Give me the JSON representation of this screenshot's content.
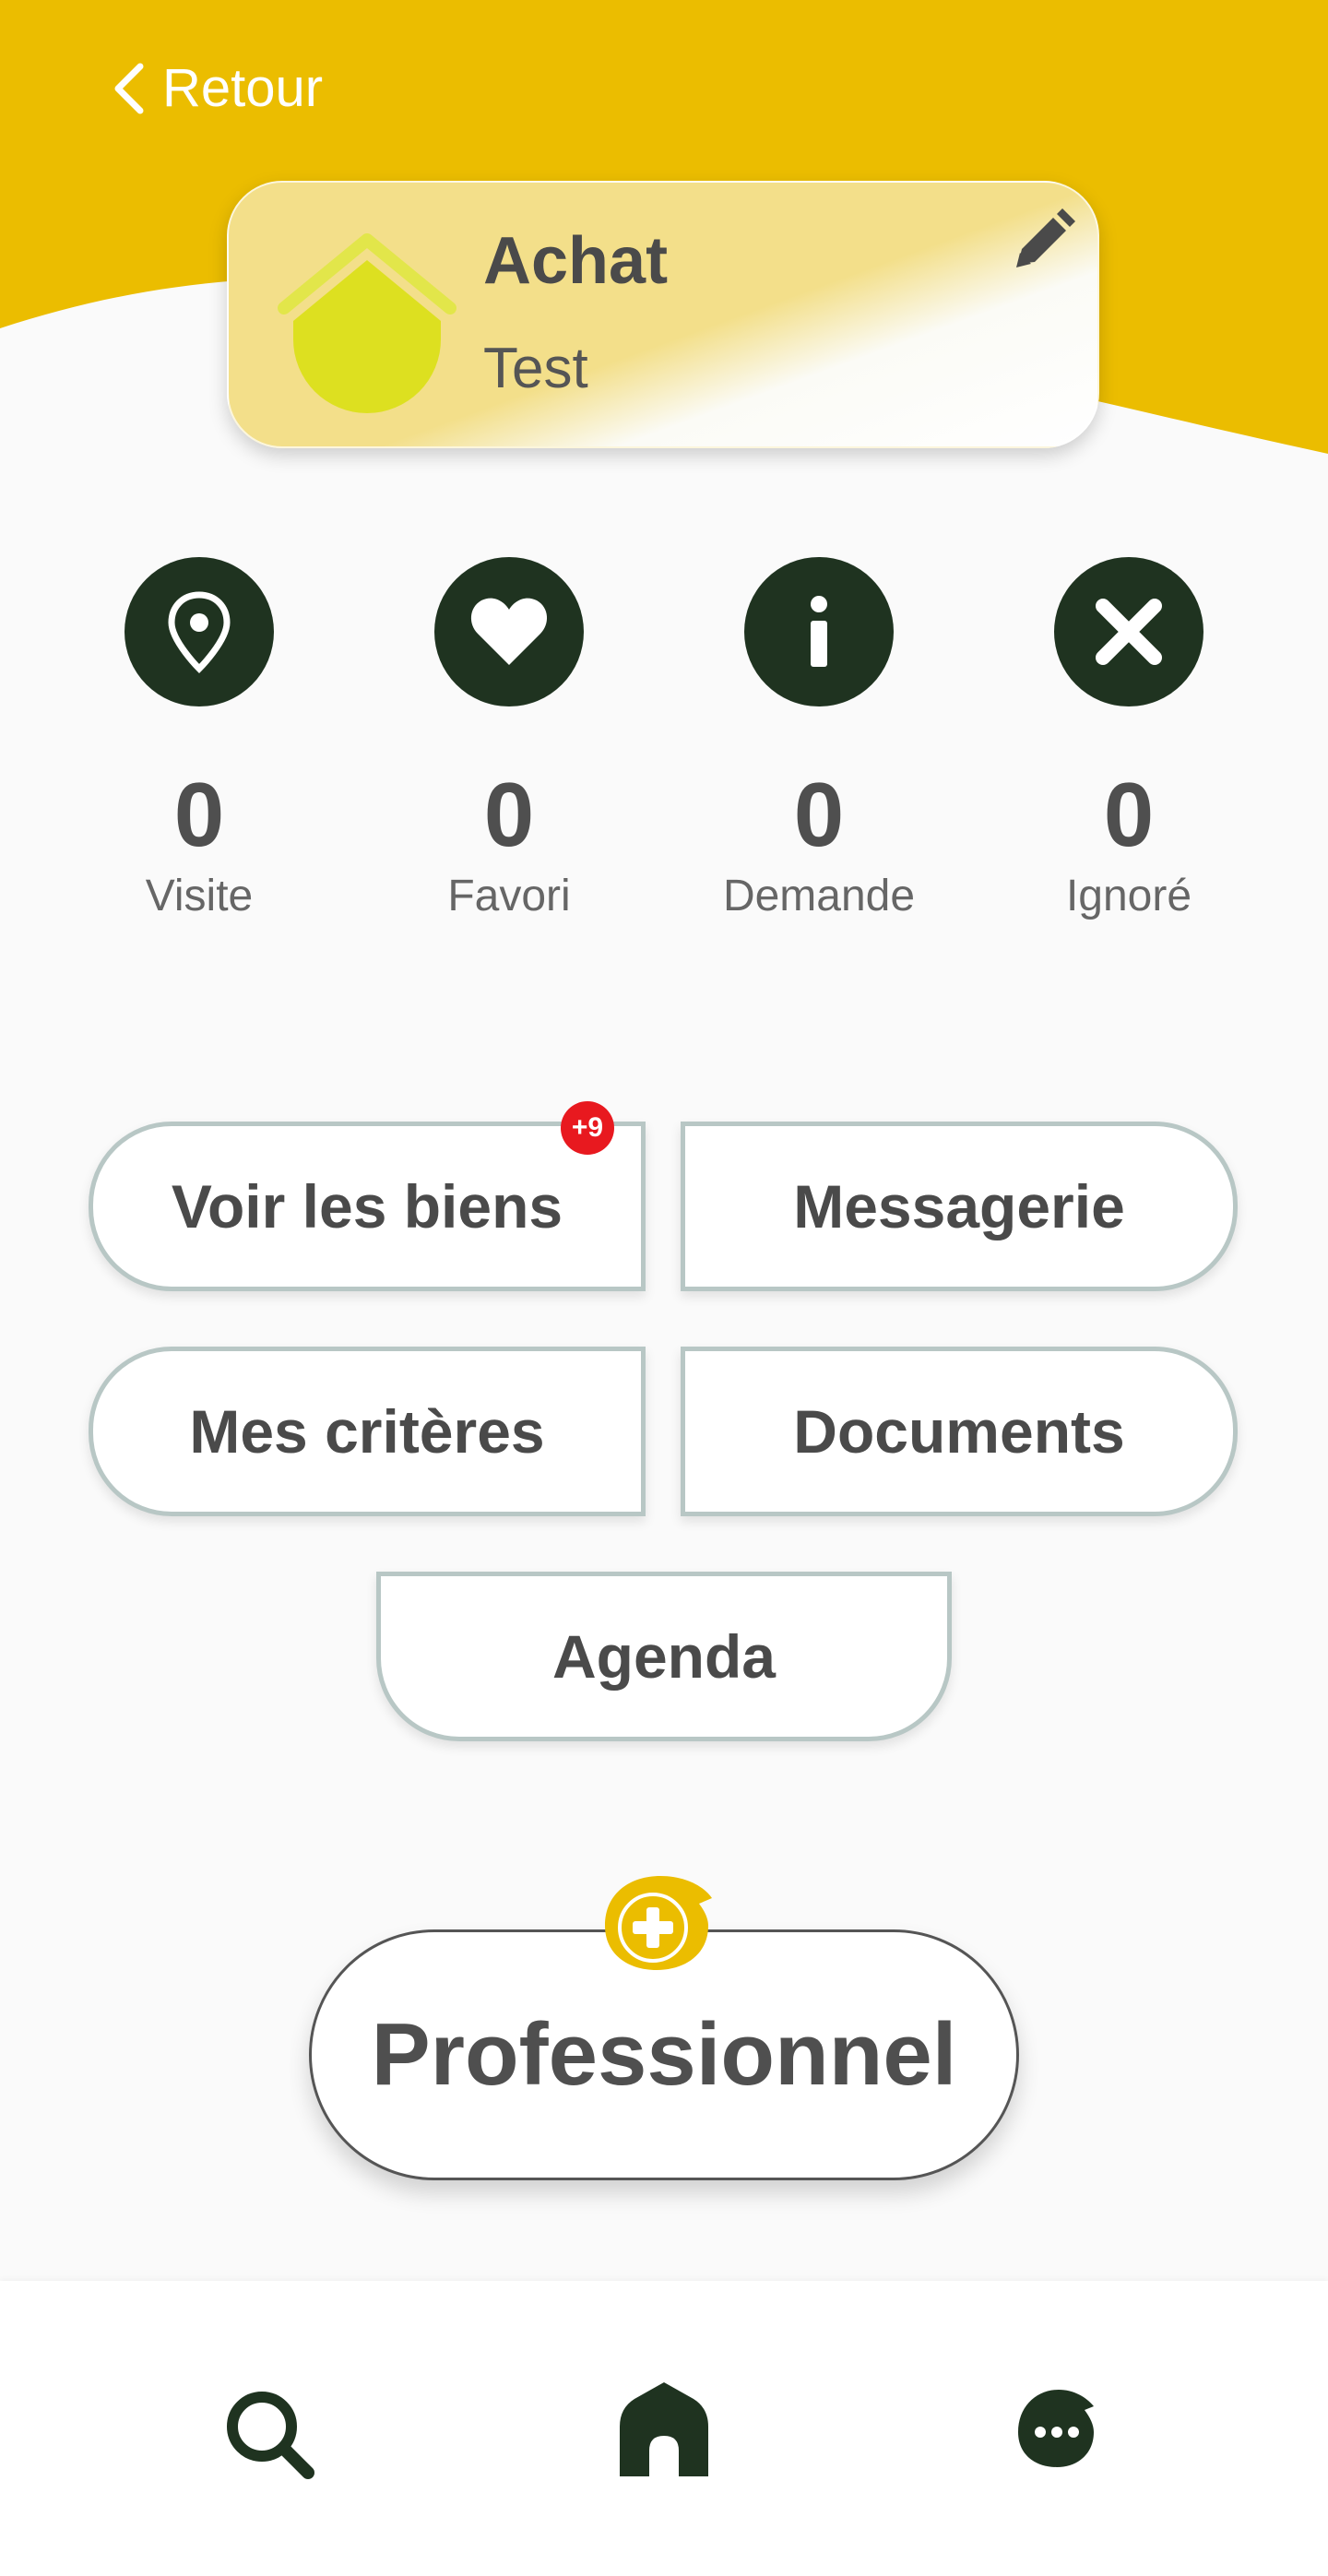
{
  "header": {
    "back_label": "Retour",
    "accent_color": "#ebbd00"
  },
  "project_card": {
    "title": "Achat",
    "subtitle": "Test",
    "logo_icon": "house-logo-icon",
    "edit_icon": "pencil-icon"
  },
  "stats": [
    {
      "icon": "location-pin-icon",
      "count": "0",
      "label": "Visite"
    },
    {
      "icon": "heart-icon",
      "count": "0",
      "label": "Favori"
    },
    {
      "icon": "info-icon",
      "count": "0",
      "label": "Demande"
    },
    {
      "icon": "close-icon",
      "count": "0",
      "label": "Ignoré"
    }
  ],
  "actions": {
    "view_properties": "Voir les biens",
    "view_properties_badge": "+9",
    "messaging": "Messagerie",
    "criteria": "Mes critères",
    "documents": "Documents",
    "agenda": "Agenda"
  },
  "professional_button": {
    "label": "Professionnel",
    "icon": "plus-bubble-icon"
  },
  "bottom_nav": [
    {
      "icon": "search-icon"
    },
    {
      "icon": "home-icon"
    },
    {
      "icon": "chat-bubble-icon"
    }
  ],
  "colors": {
    "dark_green": "#1f3320",
    "yellow": "#ebbd00",
    "lime": "#dde020",
    "badge_red": "#e8191f"
  }
}
